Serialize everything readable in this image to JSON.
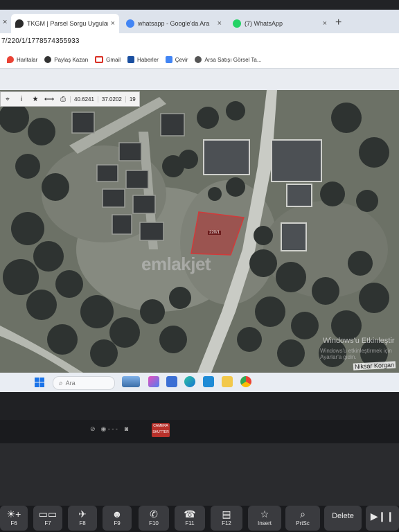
{
  "browser": {
    "tabs": [
      {
        "title": "TKGM | Parsel Sorgu Uygulamas",
        "favicon_color": "#2c2c2c"
      },
      {
        "title": "whatsapp - Google'da Ara",
        "favicon_color": "#4285f4"
      },
      {
        "title": "(7) WhatsApp",
        "favicon_color": "#25d366"
      }
    ],
    "close_glyph": "×",
    "new_tab_glyph": "+",
    "url": "7/220/1/1778574355933"
  },
  "bookmarks": [
    {
      "label": "Haritalar",
      "icon": "maps-icon",
      "color": "#ea4335"
    },
    {
      "label": "Paylaş Kazan",
      "icon": "share-icon",
      "color": "#333333"
    },
    {
      "label": "Gmail",
      "icon": "gmail-icon",
      "color": "#d93025"
    },
    {
      "label": "Haberler",
      "icon": "news-icon",
      "color": "#1a4fa0"
    },
    {
      "label": "Çevir",
      "icon": "translate-icon",
      "color": "#4285f4"
    },
    {
      "label": "Arsa Satışı Görsel Ta...",
      "icon": "web-icon",
      "color": "#555555"
    }
  ],
  "map": {
    "toolbar": {
      "icons": [
        "target-icon",
        "info-icon",
        "star-icon",
        "measure-icon",
        "print-icon"
      ],
      "icon_glyphs": [
        "⌖",
        "i",
        "★",
        "⟷",
        "⎙"
      ],
      "lat": "40.6241",
      "lon": "37.0202",
      "zoom": "19"
    },
    "parcel_label": "220/1",
    "watermark": "emlakjet",
    "road_label": "Niksar Korgan",
    "activation_title": "Windows'u Etkinleştir",
    "activation_sub": "Windows'u etkinleştirmek için Ayarlar'a gidin."
  },
  "taskbar": {
    "search_placeholder": "Ara",
    "apps": [
      "weather-icon",
      "copilot-icon",
      "widgets-icon",
      "edge-icon",
      "store-icon",
      "explorer-icon",
      "chrome-icon"
    ]
  },
  "keyboard": {
    "keys": [
      {
        "label": "F6",
        "glyph": "☀+"
      },
      {
        "label": "F7",
        "glyph": "▭▭"
      },
      {
        "label": "F8",
        "glyph": "✈"
      },
      {
        "label": "F9",
        "glyph": "☻"
      },
      {
        "label": "F10",
        "glyph": "✆"
      },
      {
        "label": "F11",
        "glyph": "☎"
      },
      {
        "label": "F12",
        "glyph": "▤"
      },
      {
        "label": "Insert",
        "glyph": "☆"
      },
      {
        "label": "PrtSc",
        "glyph": "⌕"
      },
      {
        "label": "Delete",
        "glyph": ""
      },
      {
        "label": "",
        "glyph": "▶❙❙"
      }
    ],
    "camera_badge": "CAMERA SHUTTER"
  },
  "colors": {
    "parcel_fill": "#b33030",
    "accent_chrome": "#1a73e8"
  }
}
